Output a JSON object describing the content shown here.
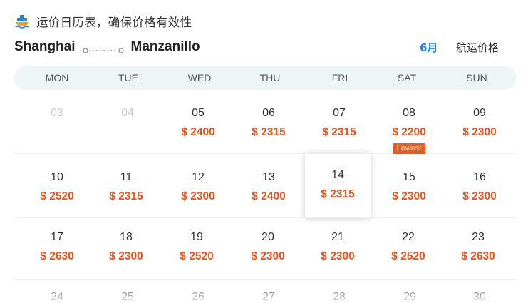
{
  "header": {
    "icon": "ship-icon",
    "text": "运价日历表，确保价格有效性"
  },
  "route": {
    "origin": "Shanghai",
    "destination": "Manzanillo",
    "month": "6月",
    "freight_label": "航运价格"
  },
  "weekdays": [
    "MON",
    "TUE",
    "WED",
    "THU",
    "FRI",
    "SAT",
    "SUN"
  ],
  "colors": {
    "accent_blue": "#1a86e0",
    "price_orange": "#e8561f",
    "badge_orange": "#ef5a1a",
    "weekbar_bg": "#eef5f7"
  },
  "calendar": {
    "week1": {
      "mon": {
        "day": "03"
      },
      "tue": {
        "day": "04"
      },
      "wed": {
        "day": "05",
        "price": "$ 2400"
      },
      "thu": {
        "day": "06",
        "price": "$ 2315"
      },
      "fri": {
        "day": "07",
        "price": "$ 2315"
      },
      "sat": {
        "day": "08",
        "price": "$ 2200",
        "badge": "Lowest"
      },
      "sun": {
        "day": "09",
        "price": "$ 2300"
      }
    },
    "week2": {
      "mon": {
        "day": "10",
        "price": "$ 2520"
      },
      "tue": {
        "day": "11",
        "price": "$ 2315"
      },
      "wed": {
        "day": "12",
        "price": "$ 2300"
      },
      "thu": {
        "day": "13",
        "price": "$ 2400"
      },
      "fri": {
        "day": "14",
        "price": "$ 2315"
      },
      "sat": {
        "day": "15",
        "price": "$ 2300"
      },
      "sun": {
        "day": "16",
        "price": "$ 2300"
      }
    },
    "week3": {
      "mon": {
        "day": "17",
        "price": "$ 2630"
      },
      "tue": {
        "day": "18",
        "price": "$ 2300"
      },
      "wed": {
        "day": "19",
        "price": "$ 2520"
      },
      "thu": {
        "day": "20",
        "price": "$ 2300"
      },
      "fri": {
        "day": "21",
        "price": "$ 2300"
      },
      "sat": {
        "day": "22",
        "price": "$ 2520"
      },
      "sun": {
        "day": "23",
        "price": "$ 2630"
      }
    },
    "week4": {
      "mon": {
        "day": "24"
      },
      "tue": {
        "day": "25"
      },
      "wed": {
        "day": "26"
      },
      "thu": {
        "day": "27"
      },
      "fri": {
        "day": "28"
      },
      "sat": {
        "day": "29"
      },
      "sun": {
        "day": "30"
      }
    }
  }
}
